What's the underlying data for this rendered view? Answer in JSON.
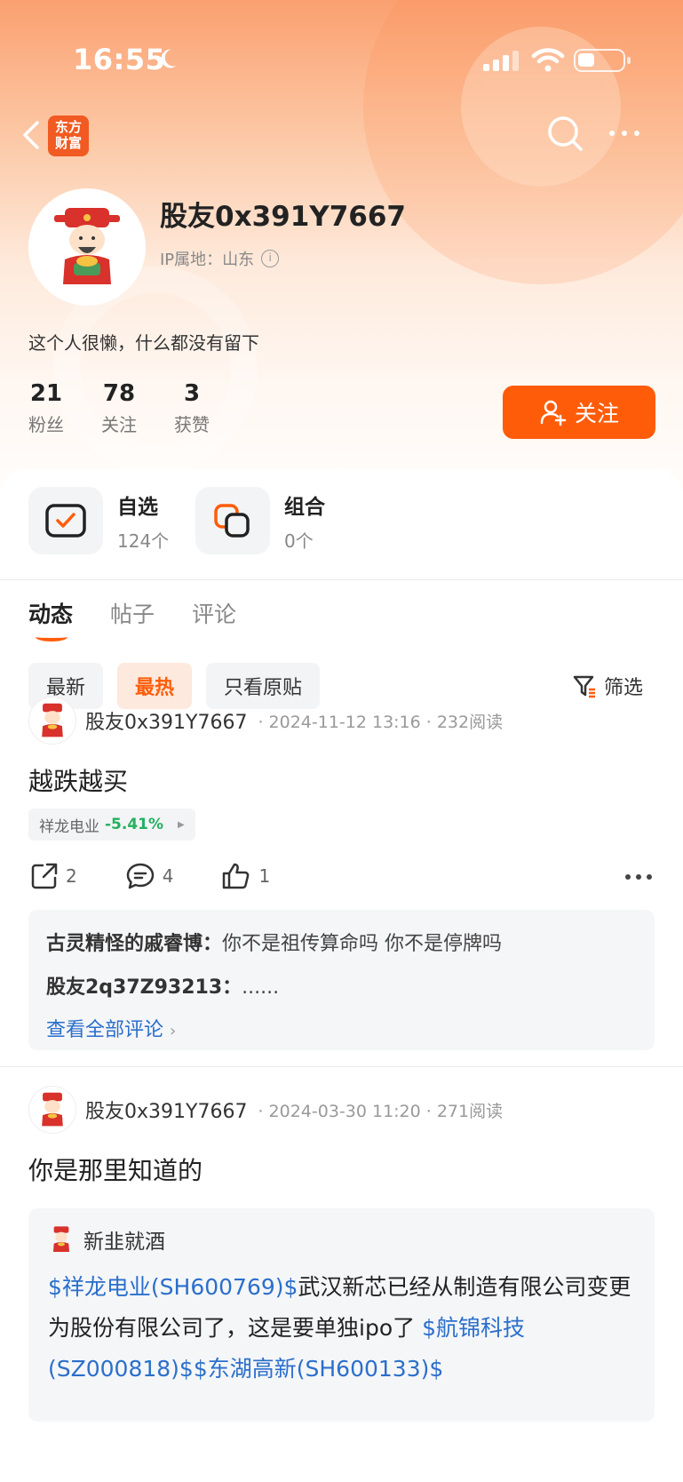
{
  "status": {
    "time": "16:55"
  },
  "nav": {
    "logo_line1": "东方",
    "logo_line2": "财富"
  },
  "profile": {
    "username": "股友0x391Y7667",
    "ip": "IP属地：山东",
    "bio": "这个人很懒，什么都没有留下",
    "stats": [
      {
        "num": "21",
        "label": "粉丝"
      },
      {
        "num": "78",
        "label": "关注"
      },
      {
        "num": "3",
        "label": "获赞"
      }
    ],
    "follow_label": "关注"
  },
  "quick": {
    "watchlist": {
      "title": "自选",
      "count": "124个"
    },
    "portfolio": {
      "title": "组合",
      "count": "0个"
    }
  },
  "tabs": [
    "动态",
    "帖子",
    "评论"
  ],
  "filters": {
    "chips": [
      "最新",
      "最热",
      "只看原贴"
    ],
    "filter_label": "筛选"
  },
  "posts": [
    {
      "user": "股友0x391Y7667",
      "meta": "· 2024-11-12 13:16 · 232阅读",
      "title": "越跌越买",
      "stock": {
        "name": "祥龙电业",
        "change": "-5.41%",
        "change_color": "#23b15f"
      },
      "shares": "2",
      "comments_count": "4",
      "likes": "1",
      "comments": [
        {
          "author": "古灵精怪的戚睿博：",
          "text": "你不是祖传算命吗 你不是停牌吗"
        },
        {
          "author": "股友2q37Z93213：",
          "text": "......"
        }
      ],
      "view_all": "查看全部评论"
    },
    {
      "user": "股友0x391Y7667",
      "meta": "· 2024-03-30 11:20 · 271阅读",
      "title": "你是那里知道的",
      "repost": {
        "user": "新韭就酒",
        "link1": "$祥龙电业(SH600769)$",
        "text1": "武汉新芯已经从制造有限公司变更为股份有限公司了，这是要单独ipo了",
        "link2": "$航锦科技(SZ000818)$$东湖高新(SH600133)$"
      }
    }
  ]
}
